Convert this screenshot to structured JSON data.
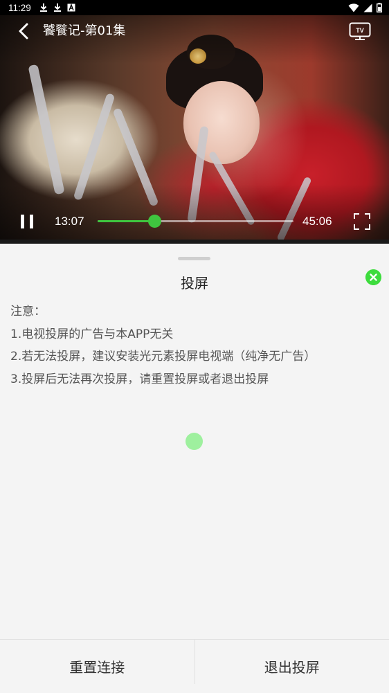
{
  "status_bar": {
    "time": "11:29",
    "left_icons": [
      "download-icon",
      "download-icon",
      "font-icon"
    ],
    "right_icons": [
      "wifi-icon",
      "signal-icon",
      "battery-icon"
    ]
  },
  "player": {
    "title": "饕餮记-第01集",
    "current_time": "13:07",
    "total_time": "45:06",
    "progress_fraction": 0.29,
    "accent_color": "#3fc53f",
    "icons": {
      "back": "back-arrow-icon",
      "cast": "tv-icon",
      "pause": "pause-icon",
      "fullscreen": "fullscreen-icon"
    }
  },
  "cast_sheet": {
    "title": "投屏",
    "notes": [
      "注意：",
      "1.电视投屏的广告与本APP无关",
      "2.若无法投屏，建议安装光元素投屏电视端（纯净无广告）",
      "3.投屏后无法再次投屏，请重置投屏或者退出投屏"
    ],
    "close_icon": "close-icon",
    "buttons": {
      "reset": "重置连接",
      "exit": "退出投屏"
    }
  }
}
